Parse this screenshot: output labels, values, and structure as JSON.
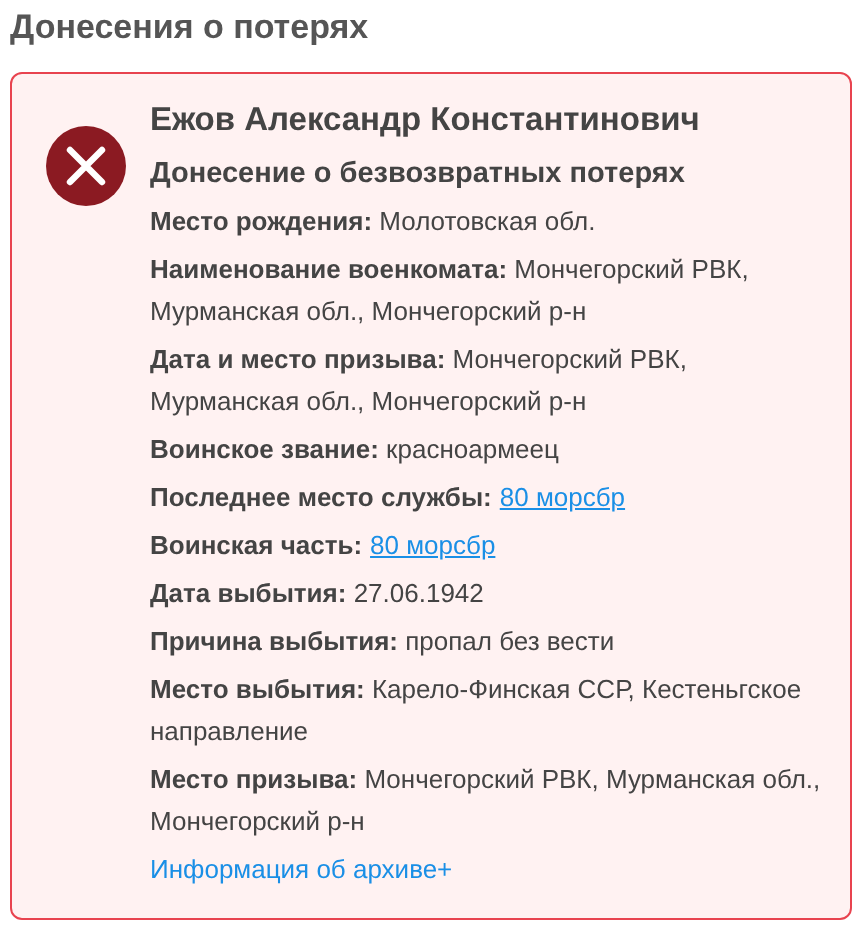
{
  "heading": "Донесения о потерях",
  "record": {
    "lost": true,
    "name": "Ежов Александр Константинович",
    "document": "Донесение о безвозвратных потерях",
    "fields": [
      {
        "kind": "text",
        "text": "**Место рождения:** Молотовская обл."
      },
      {
        "kind": "text",
        "text": "**Наименование военкомата:** Мончегорский РВК, Мурманская обл., Мончегорский р-н"
      },
      {
        "kind": "text",
        "text": "**Дата и место призыва:** Мончегорский РВК, Мурманская обл., Мончегорский р-н"
      },
      {
        "kind": "text",
        "text": "**Воинское звание:** красноармеец"
      },
      {
        "kind": "link",
        "label": "Последнее место службы:",
        "link": "80 морсбр"
      },
      {
        "kind": "link",
        "label": "Воинская часть:",
        "link": "80 морсбр"
      },
      {
        "kind": "text",
        "text": "**Дата выбытия:** 27.06.1942"
      },
      {
        "kind": "text",
        "text": "**Причина выбытия:** пропал без вести"
      },
      {
        "kind": "text",
        "text": "**Место выбытия:** Карело-Финская ССР, Кестеньгское направление"
      },
      {
        "kind": "text",
        "text": "**Место призыва:** Мончегорский РВК, Мурманская обл., Мончегорский р-н"
      }
    ],
    "archive_link": "Информация об архиве+"
  }
}
